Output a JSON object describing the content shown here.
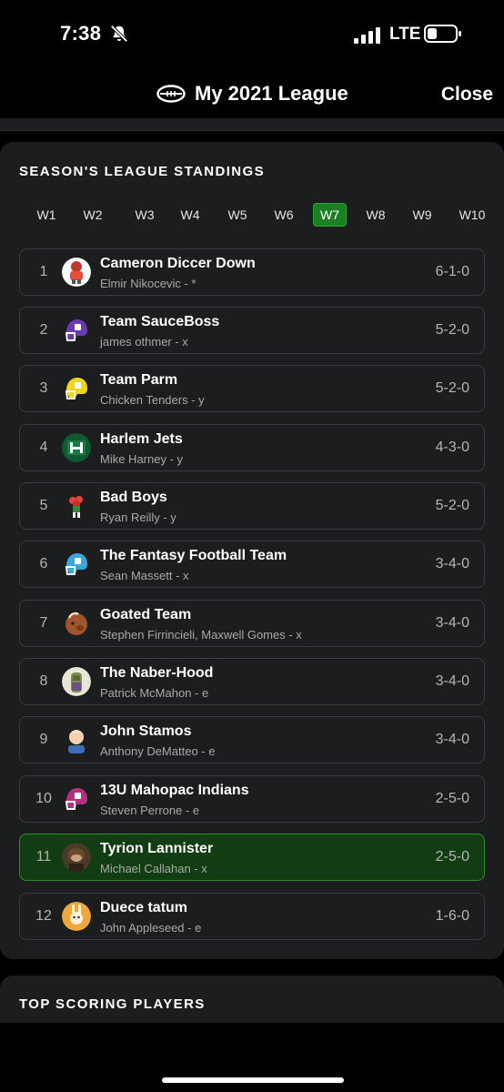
{
  "status_bar": {
    "time": "7:38",
    "network": "LTE"
  },
  "nav": {
    "title": "My 2021 League",
    "close_label": "Close"
  },
  "standings": {
    "title": "SEASON'S LEAGUE STANDINGS",
    "weeks": [
      "W1",
      "W2",
      "W3",
      "W4",
      "W5",
      "W6",
      "W7",
      "W8",
      "W9",
      "W10"
    ],
    "selected_week": "W7",
    "rows": [
      {
        "rank": "1",
        "team": "Cameron Diccer Down",
        "owner": "Elmir Nikocevic - *",
        "record": "6-1-0",
        "logo": "red-player-icon"
      },
      {
        "rank": "2",
        "team": "Team SauceBoss",
        "owner": "james othmer - x",
        "record": "5-2-0",
        "logo": "purple-helmet-icon"
      },
      {
        "rank": "3",
        "team": "Team Parm",
        "owner": "Chicken Tenders - y",
        "record": "5-2-0",
        "logo": "yellow-helmet-icon"
      },
      {
        "rank": "4",
        "team": "Harlem Jets",
        "owner": "Mike Harney - y",
        "record": "4-3-0",
        "logo": "jets-logo-icon"
      },
      {
        "rank": "5",
        "team": "Bad Boys",
        "owner": "Ryan Reilly - y",
        "record": "5-2-0",
        "logo": "flower-player-icon"
      },
      {
        "rank": "6",
        "team": "The Fantasy Football Team",
        "owner": "Sean Massett - x",
        "record": "3-4-0",
        "logo": "blue-helmet-icon"
      },
      {
        "rank": "7",
        "team": "Goated Team",
        "owner": "Stephen Firrincieli, Maxwell Gomes - x",
        "record": "3-4-0",
        "logo": "goat-icon"
      },
      {
        "rank": "8",
        "team": "The Naber-Hood",
        "owner": "Patrick McMahon - e",
        "record": "3-4-0",
        "logo": "character-avatar-icon"
      },
      {
        "rank": "9",
        "team": "John Stamos",
        "owner": "Anthony DeMatteo - e",
        "record": "3-4-0",
        "logo": "face-avatar-icon"
      },
      {
        "rank": "10",
        "team": "13U Mahopac Indians",
        "owner": "Steven Perrone - e",
        "record": "2-5-0",
        "logo": "magenta-helmet-icon"
      },
      {
        "rank": "11",
        "team": "Tyrion Lannister",
        "owner": "Michael Callahan - x",
        "record": "2-5-0",
        "logo": "photo-avatar-icon"
      },
      {
        "rank": "12",
        "team": "Duece tatum",
        "owner": "John Appleseed - e",
        "record": "1-6-0",
        "logo": "bunny-avatar-icon"
      }
    ],
    "highlighted_rank": "11"
  },
  "top_scoring": {
    "title": "TOP SCORING PLAYERS"
  },
  "colors": {
    "accent_green": "#1d7f24",
    "highlight_row": "#123d12"
  }
}
